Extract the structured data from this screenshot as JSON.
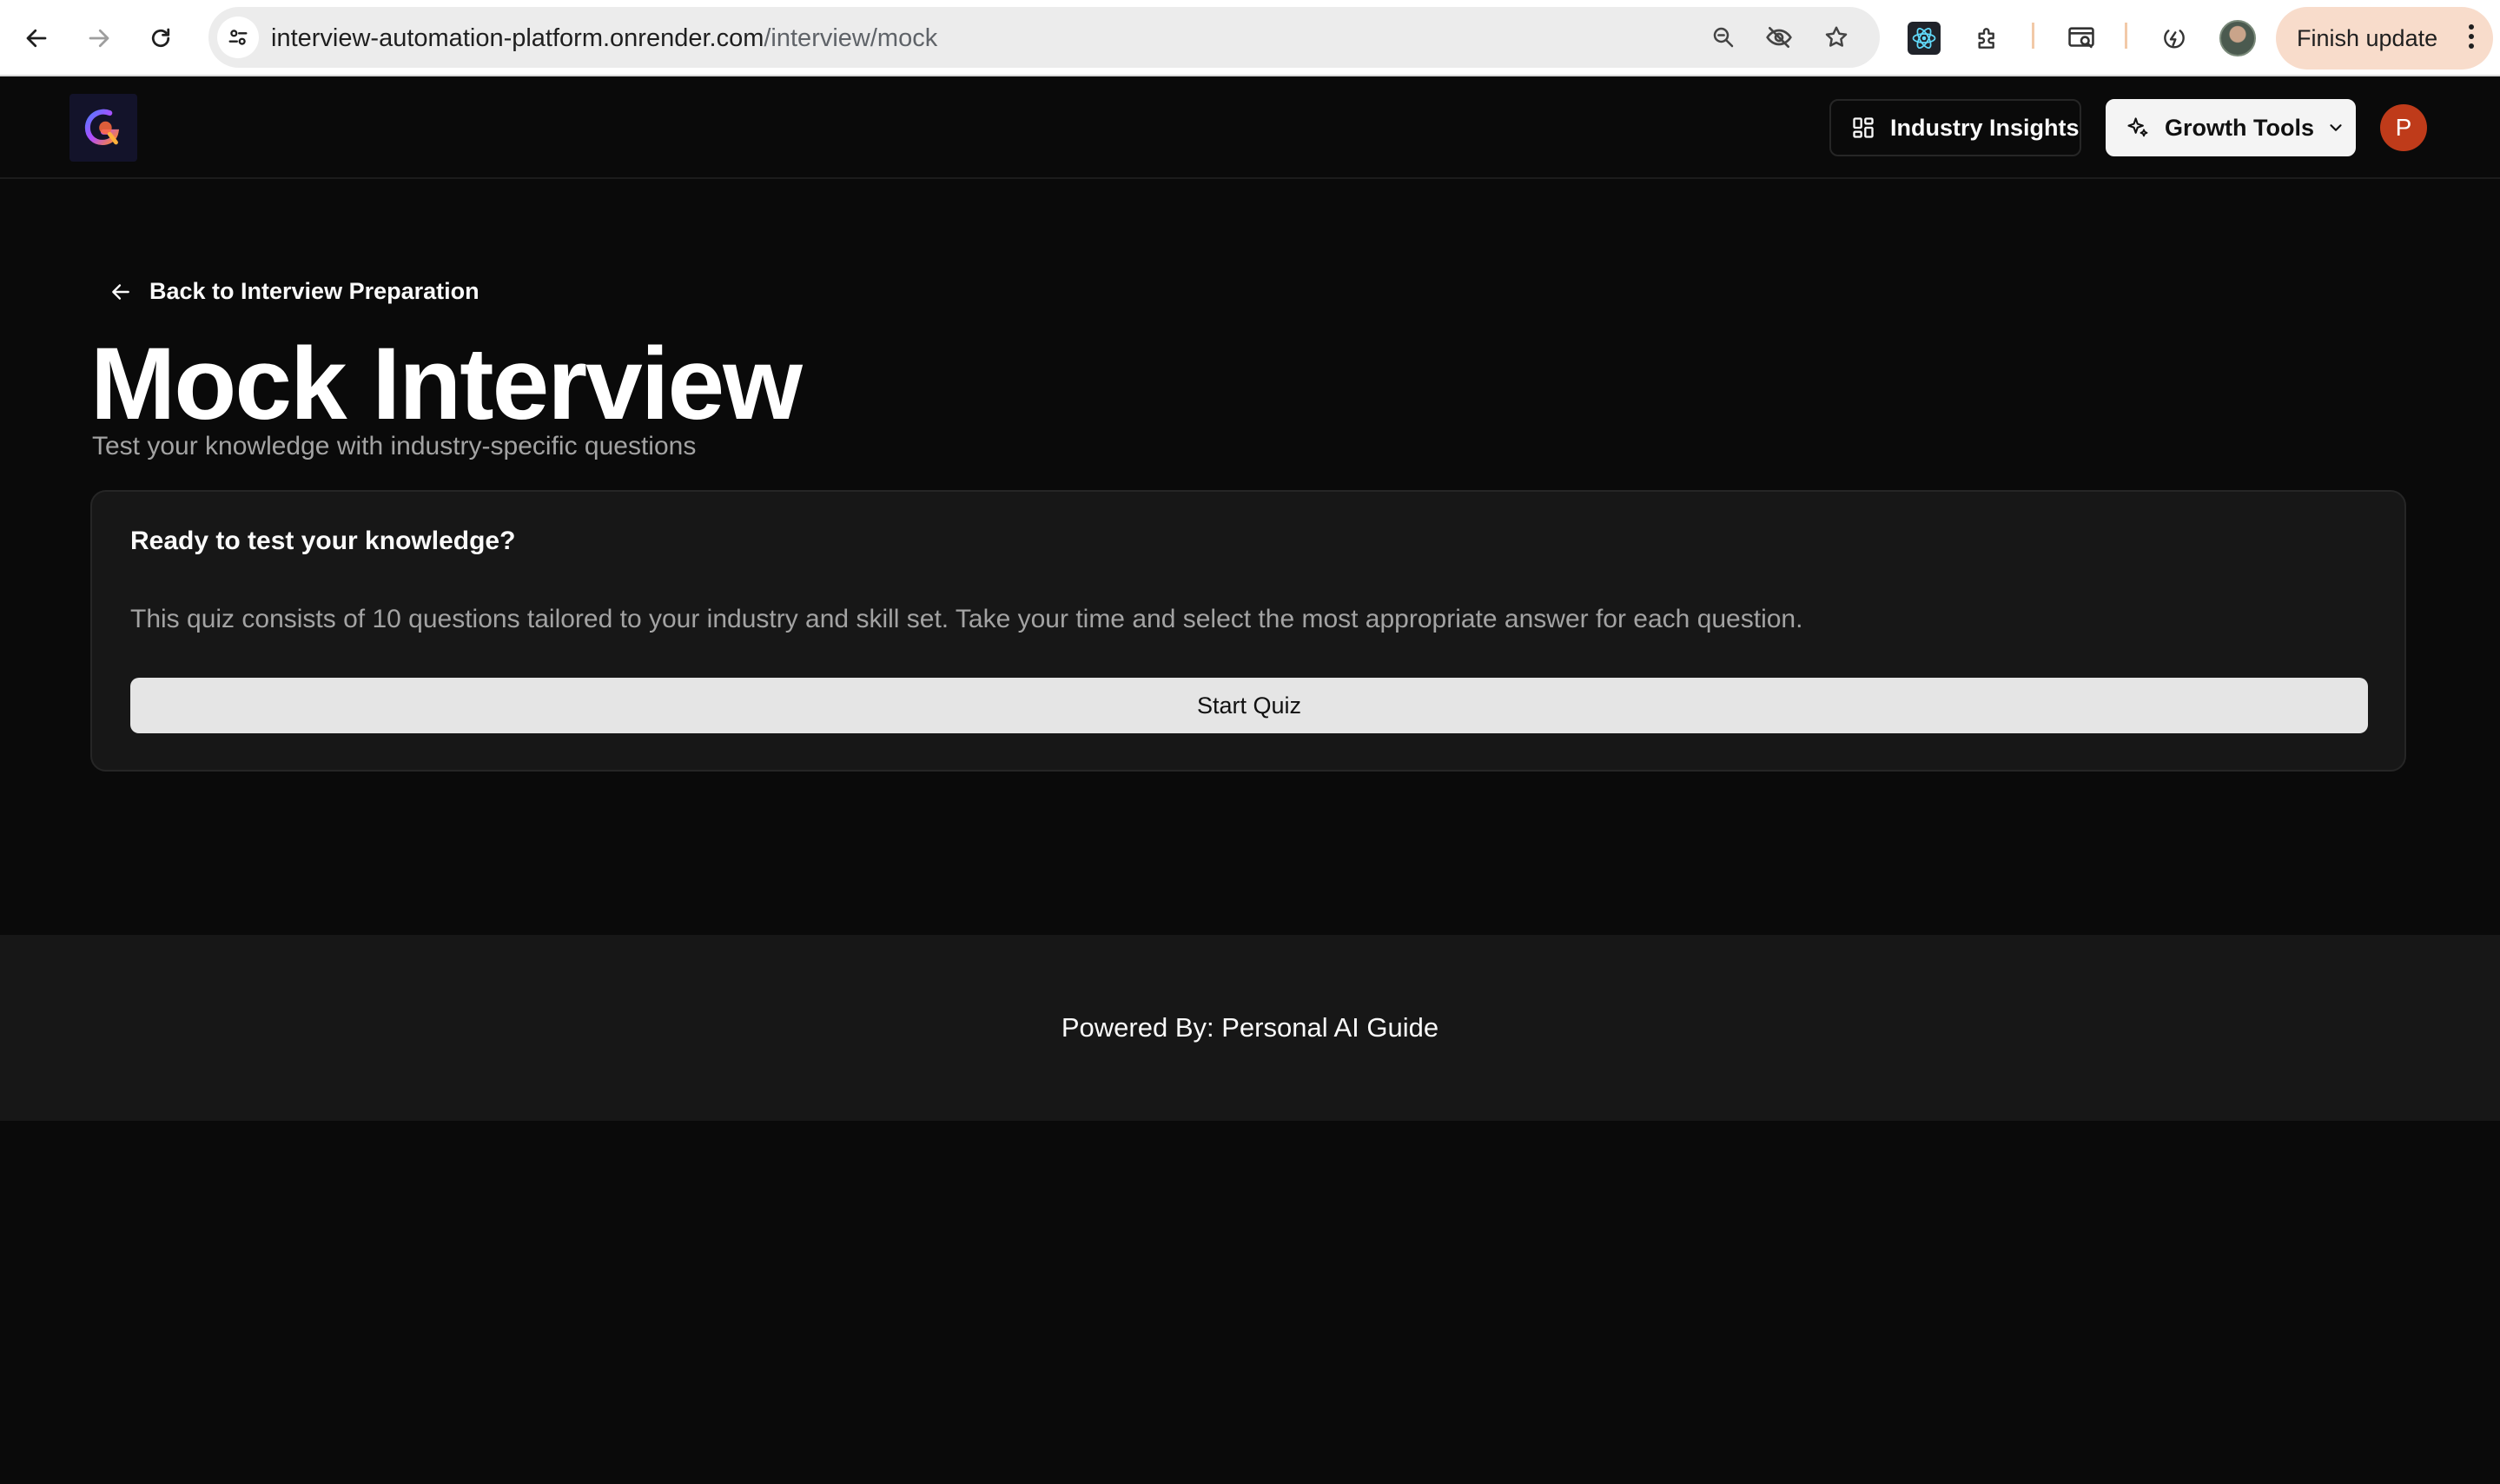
{
  "browser": {
    "url_host": "interview-automation-platform.onrender.com",
    "url_path": "/interview/mock",
    "update_label": "Finish update",
    "icons": [
      "back-icon",
      "forward-icon",
      "reload-icon",
      "site-info-icon",
      "zoom-icon",
      "eye-off-icon",
      "star-icon",
      "react-devtools-icon",
      "extensions-icon",
      "search-tab-icon",
      "performance-icon",
      "more-vert-icon"
    ]
  },
  "header": {
    "industry_insights_label": "Industry Insights",
    "growth_tools_label": "Growth Tools",
    "avatar_initial": "P"
  },
  "main": {
    "back_label": "Back to Interview Preparation",
    "title": "Mock Interview",
    "subtitle": "Test your knowledge with industry-specific questions",
    "card": {
      "title": "Ready to test your knowledge?",
      "description": "This quiz consists of 10 questions tailored to your industry and skill set. Take your time and select the most appropriate answer for each question.",
      "start_label": "Start Quiz"
    }
  },
  "footer": {
    "text": "Powered By: Personal AI Guide"
  },
  "colors": {
    "background": "#0a0a0a",
    "card": "#171717",
    "avatar": "#bf3b1a",
    "primary_button": "#e5e5e5",
    "update_pill": "#f8dccb"
  }
}
